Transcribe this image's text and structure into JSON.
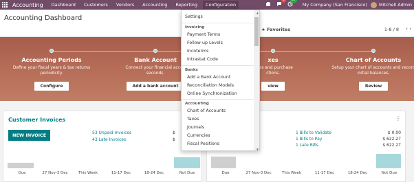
{
  "navbar": {
    "app_name": "Accounting",
    "menu": [
      "Dashboard",
      "Customers",
      "Vendors",
      "Accounting",
      "Reporting",
      "Configuration"
    ],
    "messages_count": "5",
    "activities_count": "37",
    "company": "My Company (San Francisco)",
    "user": "Mitchell Admin"
  },
  "control_panel": {
    "title": "Accounting Dashboard",
    "favorites": "Favorites",
    "pager": "1-8 / 8"
  },
  "banner": {
    "steps": [
      {
        "title": "Accounting Periods",
        "desc1": "Define your fiscal years & tax returns",
        "desc2": "periodicity.",
        "button": "Configure"
      },
      {
        "title": "Bank Account",
        "desc1": "Connect your financial accou",
        "desc2": "seconds.",
        "button": "Add a bank account"
      },
      {
        "title": "xes",
        "desc1": "sales and purchase",
        "desc2": "ctions.",
        "button": "view"
      },
      {
        "title": "Chart of Accounts",
        "desc1": "Setup your chart of accounts and record",
        "desc2": "initial balances.",
        "button": "Review"
      }
    ]
  },
  "customer_invoices": {
    "title": "Customer Invoices",
    "new_button": "NEW INVOICE",
    "unpaid": "53 Unpaid Invoices",
    "late": "43 Late Invoices",
    "unpaid_amount": "$",
    "late_amount": "$",
    "axis": [
      "Due",
      "27 Nov-3 Dec",
      "This Week",
      "11-17 Dec",
      "18-24 Dec",
      "Not Due"
    ]
  },
  "vendor_bills": {
    "to_validate": "1 Bills to Validate",
    "to_pay": "1 Bills to Pay",
    "late": "1 Late Bills",
    "to_validate_amount": "$ 0.00",
    "to_pay_amount": "$ 622.27",
    "late_amount": "$ 622.27",
    "axis": [
      "Due",
      "27 Nov-3 Dec",
      "This Week",
      "11-17 Dec",
      "18-24 Dec",
      "Not Due"
    ]
  },
  "dropdown": {
    "settings": "Settings",
    "invoicing_header": "Invoicing",
    "invoicing": [
      "Payment Terms",
      "Follow-up Levels",
      "Incoterms",
      "Intrastat Code"
    ],
    "banks_header": "Banks",
    "banks": [
      "Add a Bank Account",
      "Reconciliation Models",
      "Online Synchronization"
    ],
    "accounting_header": "Accounting",
    "accounting": [
      "Chart of Accounts",
      "Taxes",
      "Journals",
      "Currencies",
      "Fiscal Positions"
    ]
  },
  "colors": {
    "navbar": "#714b67",
    "accent": "#017e84",
    "banner": "#b66d58"
  }
}
